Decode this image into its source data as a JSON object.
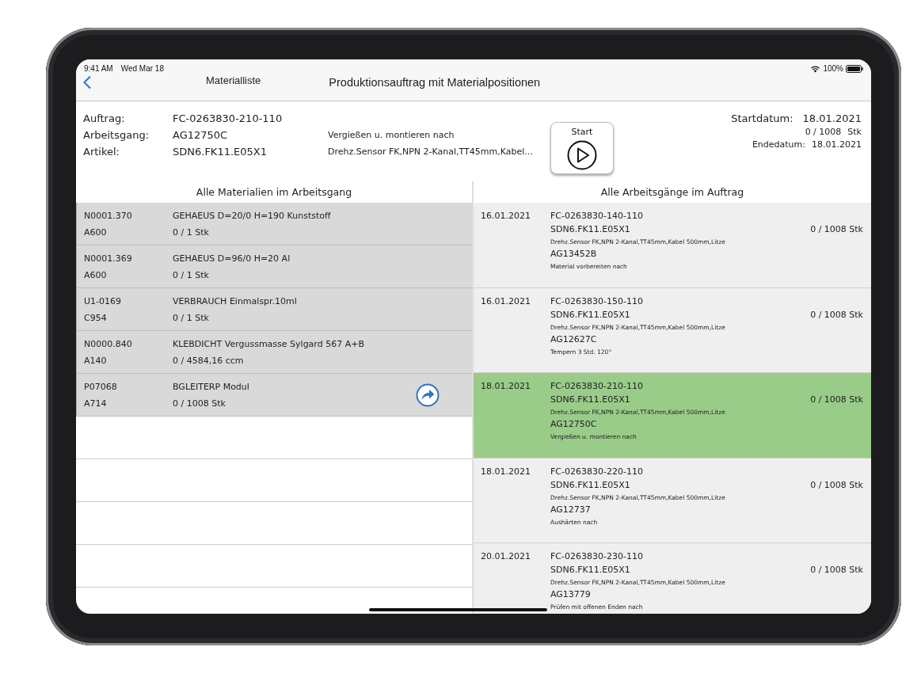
{
  "status_bar": {
    "time": "9:41 AM",
    "date": "Wed Mar 18",
    "battery": "100%"
  },
  "nav": {
    "back_label": "Materialliste",
    "title": "Produktionsauftrag mit Materialpositionen"
  },
  "order": {
    "fields": [
      {
        "label": "Auftrag:",
        "value": "FC-0263830-210-110"
      },
      {
        "label": "Arbeitsgang:",
        "value": "AG12750C",
        "note": "Vergießen u. montieren nach"
      },
      {
        "label": "Artikel:",
        "value": "SDN6.FK11.E05X1",
        "note": "Drehz.Sensor FK,NPN 2-Kanal,TT45mm,Kabel..."
      }
    ],
    "start_button": {
      "label": "Start"
    },
    "start_label": "Startdatum:",
    "start_date": "18.01.2021",
    "quantity": "0 / 1008",
    "unit": "Stk",
    "end_label": "Endedatum:",
    "end_date": "18.01.2021"
  },
  "materials": {
    "title": "Alle Materialien im Arbeitsgang",
    "rows": [
      {
        "code": "N0001.370",
        "location": "A600",
        "name": "GEHAEUS D=20/0 H=190 Kunststoff",
        "quantity": "0 / 1 Stk",
        "action": false
      },
      {
        "code": "N0001.369",
        "location": "A600",
        "name": "GEHAEUS D=96/0 H=20 Al",
        "quantity": "0 / 1 Stk",
        "action": false
      },
      {
        "code": "U1-0169",
        "location": "C954",
        "name": "VERBRAUCH Einmalspr.10ml",
        "quantity": "0 / 1 Stk",
        "action": false
      },
      {
        "code": "N0000.840",
        "location": "A140",
        "name": "KLEBDICHT Vergussmasse Sylgard 567 A+B",
        "quantity": "0 / 4584,16 ccm",
        "action": false
      },
      {
        "code": "P07068",
        "location": "A714",
        "name": "BGLEITERP Modul",
        "quantity": "0 / 1008 Stk",
        "action": true
      }
    ]
  },
  "operations": {
    "title": "Alle Arbeitsgänge im Auftrag",
    "rows": [
      {
        "date": "16.01.2021",
        "order": "FC-0263830-140-110",
        "article": "SDN6.FK11.E05X1",
        "description": "Drehz.Sensor FK,NPN 2-Kanal,TT45mm,Kabel 500mm,Litze",
        "step": "AG13452B",
        "step_text": "Material  vorbereiten nach",
        "quantity": "0 / 1008 Stk",
        "selected": false
      },
      {
        "date": "16.01.2021",
        "order": "FC-0263830-150-110",
        "article": "SDN6.FK11.E05X1",
        "description": "Drehz.Sensor FK,NPN 2-Kanal,TT45mm,Kabel 500mm,Litze",
        "step": "AG12627C",
        "step_text": "Tempern 3 Std. 120°",
        "quantity": "0 / 1008 Stk",
        "selected": false
      },
      {
        "date": "18.01.2021",
        "order": "FC-0263830-210-110",
        "article": "SDN6.FK11.E05X1",
        "description": "Drehz.Sensor FK,NPN 2-Kanal,TT45mm,Kabel 500mm,Litze",
        "step": "AG12750C",
        "step_text": "Vergießen u. montieren nach",
        "quantity": "0 / 1008 Stk",
        "selected": true
      },
      {
        "date": "18.01.2021",
        "order": "FC-0263830-220-110",
        "article": "SDN6.FK11.E05X1",
        "description": "Drehz.Sensor FK,NPN 2-Kanal,TT45mm,Kabel 500mm,Litze",
        "step": "AG12737",
        "step_text": "Aushärten nach",
        "quantity": "0 / 1008 Stk",
        "selected": false
      },
      {
        "date": "20.01.2021",
        "order": "FC-0263830-230-110",
        "article": "SDN6.FK11.E05X1",
        "description": "Drehz.Sensor FK,NPN 2-Kanal,TT45mm,Kabel 500mm,Litze",
        "step": "AG13779",
        "step_text": "Prüfen mit offenen Enden nach",
        "quantity": "0 / 1008 Stk",
        "selected": false
      }
    ]
  }
}
